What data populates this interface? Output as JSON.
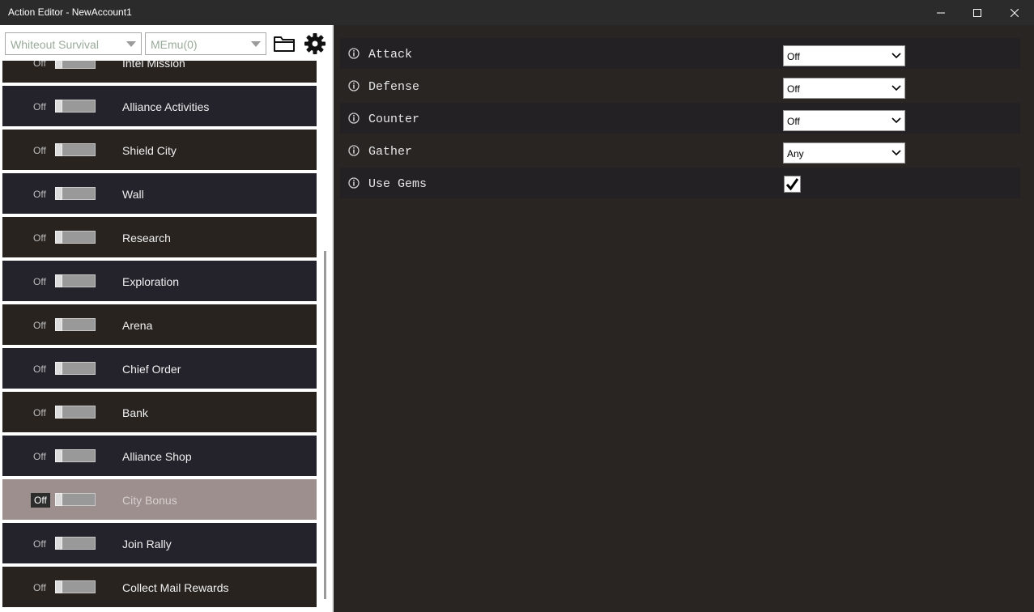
{
  "window": {
    "title": "Action Editor - NewAccount1"
  },
  "toolbar": {
    "game": "Whiteout Survival",
    "emulator": "MEmu(0)"
  },
  "actions": [
    {
      "state": "Off",
      "label": "Intel Mission"
    },
    {
      "state": "Off",
      "label": "Alliance Activities"
    },
    {
      "state": "Off",
      "label": "Shield City"
    },
    {
      "state": "Off",
      "label": "Wall"
    },
    {
      "state": "Off",
      "label": "Research"
    },
    {
      "state": "Off",
      "label": "Exploration"
    },
    {
      "state": "Off",
      "label": "Arena"
    },
    {
      "state": "Off",
      "label": "Chief Order"
    },
    {
      "state": "Off",
      "label": "Bank"
    },
    {
      "state": "Off",
      "label": "Alliance Shop"
    },
    {
      "state": "Off",
      "label": "City Bonus"
    },
    {
      "state": "Off",
      "label": "Join Rally"
    },
    {
      "state": "Off",
      "label": "Collect Mail Rewards"
    }
  ],
  "settings": [
    {
      "name": "Attack",
      "value": "Off"
    },
    {
      "name": "Defense",
      "value": "Off"
    },
    {
      "name": "Counter",
      "value": "Off"
    },
    {
      "name": "Gather",
      "value": "Any"
    },
    {
      "name": "Use Gems",
      "checked": true
    }
  ]
}
